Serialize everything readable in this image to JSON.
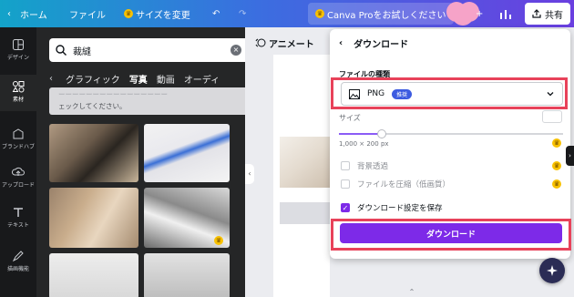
{
  "topbar": {
    "back_icon": "chevron-left-icon",
    "home_label": "ホーム",
    "file_label": "ファイル",
    "resize_label": "サイズを変更",
    "pro_label": "Canva Proをお試しください",
    "plus": "+",
    "share_label": "共有",
    "gradient_from": "#13a3c9",
    "gradient_to": "#6a3fe0"
  },
  "rail": {
    "items": [
      {
        "label": "デザイン",
        "icon": "layout-icon"
      },
      {
        "label": "素材",
        "icon": "elements-icon"
      },
      {
        "label": "ブランドハブ",
        "icon": "brand-icon"
      },
      {
        "label": "アップロード",
        "icon": "upload-icon"
      },
      {
        "label": "テキスト",
        "icon": "text-icon"
      },
      {
        "label": "描画機能",
        "icon": "draw-icon"
      }
    ]
  },
  "panel": {
    "search_value": "裁縫",
    "tabs": [
      "グラフィック",
      "写真",
      "動画",
      "オーディ"
    ],
    "active_tab": "写真",
    "banner_line1": "ーーーーーーーーーーーーーーーー",
    "banner_line2": "ェックしてください。"
  },
  "canvas": {
    "animate_label": "アニメート"
  },
  "download": {
    "title": "ダウンロード",
    "file_type_label": "ファイルの種類",
    "file_type_value": "PNG",
    "recommended_badge": "推奨",
    "size_label": "サイズ",
    "size_value": "1,000 × 200 px",
    "size_slider_fraction": 0.19,
    "options": [
      {
        "label": "背景透過",
        "checked": false
      },
      {
        "label": "ファイルを圧縮（低画質）",
        "checked": false
      },
      {
        "label": "ダウンロード設定を保存",
        "checked": true
      }
    ],
    "button_label": "ダウンロード",
    "accent": "#7d2ae8",
    "highlight": "#e8425a"
  }
}
